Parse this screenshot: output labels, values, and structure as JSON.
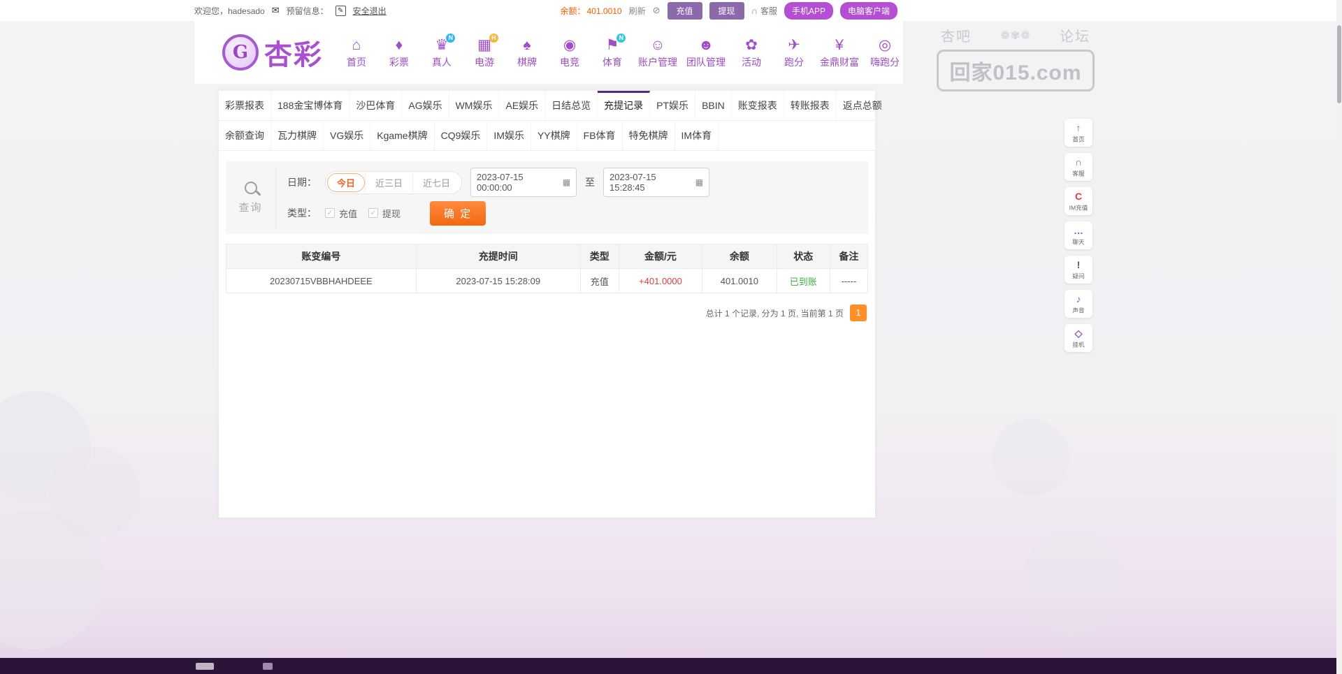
{
  "topbar": {
    "welcome": "欢迎您，hadesado",
    "reserved_label": "预留信息：",
    "logout": "安全退出",
    "balance_label": "余额：",
    "balance_value": "401.0010",
    "refresh": "刷新",
    "deposit": "充值",
    "withdraw": "提现",
    "service": "客服",
    "mobile_app": "手机APP",
    "pc_client": "电脑客户端"
  },
  "brand": {
    "name": "杏彩",
    "logo_letter": "G"
  },
  "watermark": {
    "left": "杏吧",
    "deco": "❁✾❁",
    "right": "论坛",
    "site": "回家015.com"
  },
  "nav": {
    "items": [
      {
        "name": "home",
        "label": "首页",
        "char": "⌂",
        "badge": "",
        "badge_color": ""
      },
      {
        "name": "lottery",
        "label": "彩票",
        "char": "♦",
        "badge": "",
        "badge_color": ""
      },
      {
        "name": "live",
        "label": "真人",
        "char": "♛",
        "badge": "N",
        "badge_color": "#34b6f0"
      },
      {
        "name": "egames",
        "label": "电游",
        "char": "▦",
        "badge": "H",
        "badge_color": "#f6b73c"
      },
      {
        "name": "chess",
        "label": "棋牌",
        "char": "♠",
        "badge": "",
        "badge_color": ""
      },
      {
        "name": "esports",
        "label": "电竞",
        "char": "◉",
        "badge": "",
        "badge_color": ""
      },
      {
        "name": "sports",
        "label": "体育",
        "char": "⚑",
        "badge": "N",
        "badge_color": "#35c6d9"
      },
      {
        "name": "account",
        "label": "账户管理",
        "char": "☺",
        "badge": "",
        "badge_color": ""
      },
      {
        "name": "team",
        "label": "团队管理",
        "char": "☻",
        "badge": "",
        "badge_color": ""
      },
      {
        "name": "activity",
        "label": "活动",
        "char": "✿",
        "badge": "",
        "badge_color": ""
      },
      {
        "name": "paofen",
        "label": "跑分",
        "char": "✈",
        "badge": "",
        "badge_color": ""
      },
      {
        "name": "wealth",
        "label": "金鼎财富",
        "char": "¥",
        "badge": "",
        "badge_color": ""
      },
      {
        "name": "hipaofen",
        "label": "嗨跑分",
        "char": "◎",
        "badge": "",
        "badge_color": ""
      }
    ]
  },
  "tabs": {
    "active": "充提记录",
    "row1": [
      "彩票报表",
      "188金宝博体育",
      "沙巴体育",
      "AG娱乐",
      "WM娱乐",
      "AE娱乐",
      "日结总览",
      "充提记录",
      "PT娱乐",
      "BBIN",
      "账变报表",
      "转账报表",
      "返点总额"
    ],
    "row2": [
      "余额查询",
      "瓦力棋牌",
      "VG娱乐",
      "Kgame棋牌",
      "CQ9娱乐",
      "IM娱乐",
      "YY棋牌",
      "FB体育",
      "特免棋牌",
      "IM体育"
    ]
  },
  "filter": {
    "query_label": "查询",
    "date_label": "日期：",
    "presets": [
      "今日",
      "近三日",
      "近七日"
    ],
    "active_preset": "今日",
    "date_from": "2023-07-15 00:00:00",
    "to_label": "至",
    "date_to": "2023-07-15 15:28:45",
    "type_label": "类型：",
    "type_options": [
      "充值",
      "提现"
    ],
    "submit": "确 定"
  },
  "table": {
    "headers": [
      "账变编号",
      "充提时间",
      "类型",
      "金额/元",
      "余额",
      "状态",
      "备注"
    ],
    "rows": [
      [
        "20230715VBBHAHDEEE",
        "2023-07-15 15:28:09",
        "充值",
        "+401.0000",
        "401.0010",
        "已到账",
        "-----"
      ]
    ]
  },
  "pagination": {
    "summary": "总计 1 个记录, 分为 1 页, 当前第 1 页",
    "current_page": "1"
  },
  "sidebar": {
    "items": [
      {
        "name": "home",
        "label": "首页",
        "char": "↑",
        "color": "#8a5bc0"
      },
      {
        "name": "service",
        "label": "客服",
        "char": "∩",
        "color": "#8a5bc0"
      },
      {
        "name": "im-recharge",
        "label": "IM充值",
        "char": "C",
        "color": "#e23b3b"
      },
      {
        "name": "chat",
        "label": "聊天",
        "char": "…",
        "color": "#8a5bc0"
      },
      {
        "name": "question",
        "label": "疑问",
        "char": "!",
        "color": "#555555"
      },
      {
        "name": "sound",
        "label": "声音",
        "char": "♪",
        "color": "#8a5bc0"
      },
      {
        "name": "hangup",
        "label": "挂机",
        "char": "◇",
        "color": "#8a5bc0"
      }
    ]
  },
  "colors": {
    "accent_purple": "#a14fc8",
    "dark_purple_tab": "#53277e",
    "accent_orange": "#f2680e",
    "balance_orange": "#ff5a00",
    "amount_red": "#e23b3b",
    "status_green": "#3fae49",
    "footer_bg": "#2a1438"
  }
}
